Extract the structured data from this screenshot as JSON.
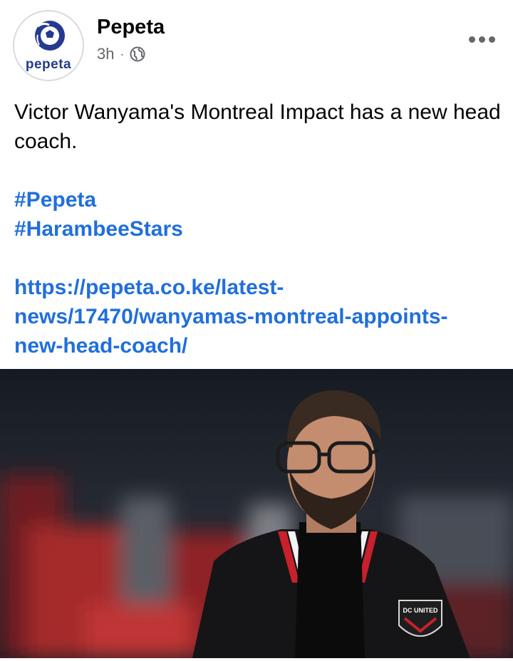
{
  "post": {
    "page_name": "Pepeta",
    "avatar_text": "pepeta",
    "time": "3h",
    "separator": "·",
    "privacy_icon": "globe-icon",
    "more_icon": "more-horizontal-icon",
    "text_line": "Victor Wanyama's Montreal Impact has a new head coach.",
    "hashtags": [
      "#Pepeta",
      "#HarambeeStars"
    ],
    "link_lines": [
      "https://pepeta.co.ke/latest-",
      "news/17470/wanyamas-montreal-appoints-",
      "new-head-coach/"
    ],
    "image_badge_text": "DC UNITED"
  },
  "colors": {
    "link": "#216fdb",
    "meta": "#65676b",
    "brand": "#243a8f"
  }
}
